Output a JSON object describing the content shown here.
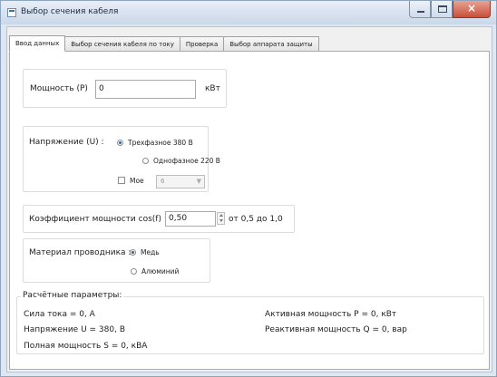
{
  "window": {
    "title": "Выбор сечения кабеля"
  },
  "tabs": [
    {
      "label": "Ввод данных",
      "active": true
    },
    {
      "label": "Выбор сечения кабеля по току",
      "active": false
    },
    {
      "label": "Проверка",
      "active": false
    },
    {
      "label": "Выбор аппарата защиты",
      "active": false
    }
  ],
  "power": {
    "label": "Мощность (P)",
    "value": "0",
    "unit": "кВт"
  },
  "voltage": {
    "label": "Напряжение (U) :",
    "options": [
      {
        "label": "Трехфазное 380 В",
        "checked": true
      },
      {
        "label": "Однофазное 220 В",
        "checked": false
      }
    ],
    "custom": {
      "label": "Мое",
      "checked": false,
      "value": "6"
    }
  },
  "power_factor": {
    "label": "Коэффициент мощности cos(f) :",
    "value": "0,50",
    "range": "от 0,5 до 1,0"
  },
  "material": {
    "label": "Материал проводника :",
    "options": [
      {
        "label": "Медь",
        "checked": true
      },
      {
        "label": "Алюминий",
        "checked": false
      }
    ]
  },
  "results": {
    "title": "Расчётные параметры:",
    "current": "Сила тока = 0, А",
    "voltage": "Напряжение U =  380, В",
    "apparent": "Полная мощность S = 0, кВА",
    "active": "Активная мощность P =  0, кВт",
    "reactive": "Реактивная мощность Q = 0, вар"
  }
}
